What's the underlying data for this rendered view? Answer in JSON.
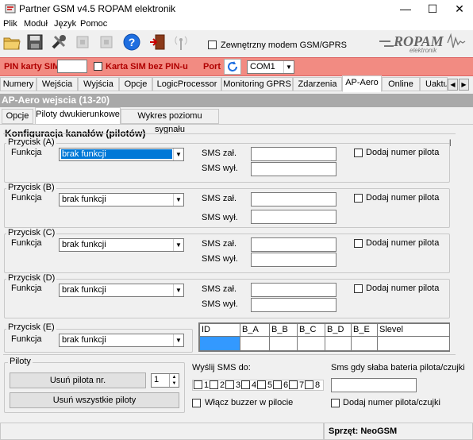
{
  "window": {
    "title": "Partner GSM v4.5 ROPAM elektronik",
    "minimize": "—",
    "maximize": "☐",
    "close": "✕"
  },
  "menu": [
    "Plik",
    "Moduł",
    "Język",
    "Pomoc"
  ],
  "toolbar": {
    "external_modem_label": "Zewnętrzny modem GSM/GPRS",
    "logo_text": "ROPAM",
    "logo_sub": "elektronik"
  },
  "simbar": {
    "pin_label": "PIN karty SIM",
    "pin_value": "",
    "no_pin_label": "Karta SIM bez PIN-u",
    "port_label": "Port",
    "port_value": "COM1"
  },
  "tabs": [
    "Numery",
    "Wejścia",
    "Wyjścia",
    "Opcje",
    "LogicProcessor",
    "Monitoring GPRS",
    "Zdarzenia",
    "AP-Aero",
    "Online",
    "Uaktu"
  ],
  "active_tab": "AP-Aero",
  "section": {
    "title": "AP-Aero  wejscia  (13-20)",
    "subtabs": [
      "Opcje",
      "Piloty dwukierunkowe",
      "Wykres poziomu sygnału"
    ],
    "config_title": "Konfiguracja kanałów (pilotów)"
  },
  "buttons_groups": [
    {
      "label": "Przycisk (A)",
      "function_label": "Funkcja",
      "function_value": "brak funkcji",
      "sms_on_label": "SMS zał.",
      "sms_off_label": "SMS wył.",
      "sms_on": "",
      "sms_off": "",
      "add_number_label": "Dodaj numer pilota"
    },
    {
      "label": "Przycisk (B)",
      "function_label": "Funkcja",
      "function_value": "brak funkcji",
      "sms_on_label": "SMS zał.",
      "sms_off_label": "SMS wył.",
      "sms_on": "",
      "sms_off": "",
      "add_number_label": "Dodaj numer pilota"
    },
    {
      "label": "Przycisk (C)",
      "function_label": "Funkcja",
      "function_value": "brak funkcji",
      "sms_on_label": "SMS zał.",
      "sms_off_label": "SMS wył.",
      "sms_on": "",
      "sms_off": "",
      "add_number_label": "Dodaj numer pilota"
    },
    {
      "label": "Przycisk (D)",
      "function_label": "Funkcja",
      "function_value": "brak funkcji",
      "sms_on_label": "SMS zał.",
      "sms_off_label": "SMS wył.",
      "sms_on": "",
      "sms_off": "",
      "add_number_label": "Dodaj numer pilota"
    }
  ],
  "button_e": {
    "label": "Przycisk (E)",
    "function_label": "Funkcja",
    "function_value": "brak funkcji"
  },
  "remotes_table": {
    "columns": [
      "ID",
      "B_A",
      "B_B",
      "B_C",
      "B_D",
      "B_E",
      "Slevel"
    ]
  },
  "piloty": {
    "label": "Piloty",
    "remove_button": "Usuń pilota nr.",
    "remove_all_button": "Usuń wszystkie piloty",
    "spinner_value": "1"
  },
  "send_sms": {
    "label": "Wyślij SMS do:",
    "numbers": [
      "1",
      "2",
      "3",
      "4",
      "5",
      "6",
      "7",
      "8"
    ],
    "buzzer_label": "Włącz buzzer w pilocie"
  },
  "battery": {
    "label": "Sms gdy słaba bateria pilota/czujki",
    "value": "",
    "add_number_label": "Dodaj numer pilota/czujki"
  },
  "status": {
    "hardware": "Sprzęt: NeoGSM"
  },
  "colors": {
    "red_bar": "#f28b82",
    "gray_bar": "#a9a9a9",
    "selection": "#0078d7"
  }
}
